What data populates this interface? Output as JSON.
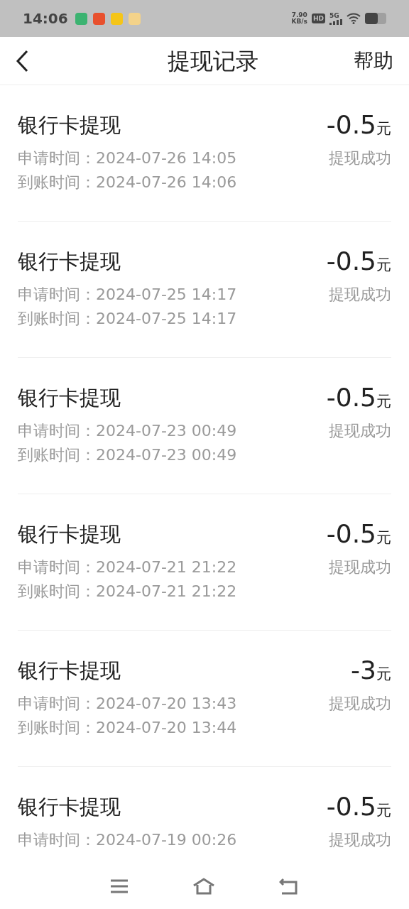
{
  "status_bar": {
    "time": "14:06",
    "speed_value": "7.90",
    "speed_unit": "KB/s",
    "hd": "HD",
    "network": "5G"
  },
  "header": {
    "title": "提现记录",
    "help": "帮助"
  },
  "records": [
    {
      "title": "银行卡提现",
      "amount": "-0.5",
      "unit": "元",
      "apply_label": "申请时间：",
      "apply_time": "2024-07-26 14:05",
      "arrive_label": "到账时间：",
      "arrive_time": "2024-07-26 14:06",
      "status": "提现成功"
    },
    {
      "title": "银行卡提现",
      "amount": "-0.5",
      "unit": "元",
      "apply_label": "申请时间：",
      "apply_time": "2024-07-25 14:17",
      "arrive_label": "到账时间：",
      "arrive_time": "2024-07-25 14:17",
      "status": "提现成功"
    },
    {
      "title": "银行卡提现",
      "amount": "-0.5",
      "unit": "元",
      "apply_label": "申请时间：",
      "apply_time": "2024-07-23 00:49",
      "arrive_label": "到账时间：",
      "arrive_time": "2024-07-23 00:49",
      "status": "提现成功"
    },
    {
      "title": "银行卡提现",
      "amount": "-0.5",
      "unit": "元",
      "apply_label": "申请时间：",
      "apply_time": "2024-07-21 21:22",
      "arrive_label": "到账时间：",
      "arrive_time": "2024-07-21 21:22",
      "status": "提现成功"
    },
    {
      "title": "银行卡提现",
      "amount": "-3",
      "unit": "元",
      "apply_label": "申请时间：",
      "apply_time": "2024-07-20 13:43",
      "arrive_label": "到账时间：",
      "arrive_time": "2024-07-20 13:44",
      "status": "提现成功"
    },
    {
      "title": "银行卡提现",
      "amount": "-0.5",
      "unit": "元",
      "apply_label": "申请时间：",
      "apply_time": "2024-07-19 00:26",
      "status": "提现成功"
    }
  ]
}
